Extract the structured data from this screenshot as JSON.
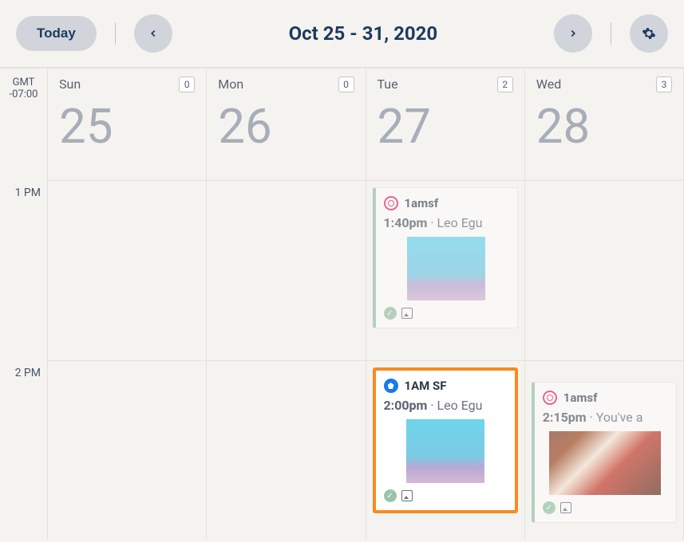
{
  "toolbar": {
    "today_label": "Today",
    "date_range": "Oct 25 - 31, 2020"
  },
  "timezone": {
    "label": "GMT",
    "offset": "-07:00"
  },
  "days": [
    {
      "name": "Sun",
      "num": "25",
      "count": "0"
    },
    {
      "name": "Mon",
      "num": "26",
      "count": "0"
    },
    {
      "name": "Tue",
      "num": "27",
      "count": "2"
    },
    {
      "name": "Wed",
      "num": "28",
      "count": "3"
    }
  ],
  "hours": [
    "1 PM",
    "2 PM"
  ],
  "posts": {
    "tue_1pm": {
      "icon": "instagram",
      "account": "1amsf",
      "time": "1:40pm",
      "caption": " · Leo Egu"
    },
    "tue_2pm": {
      "icon": "facebook",
      "account": "1AM SF",
      "time": "2:00pm",
      "caption": " · Leo Egu"
    },
    "wed_2pm": {
      "icon": "instagram",
      "account": "1amsf",
      "time": "2:15pm",
      "caption": " · You've a"
    }
  }
}
